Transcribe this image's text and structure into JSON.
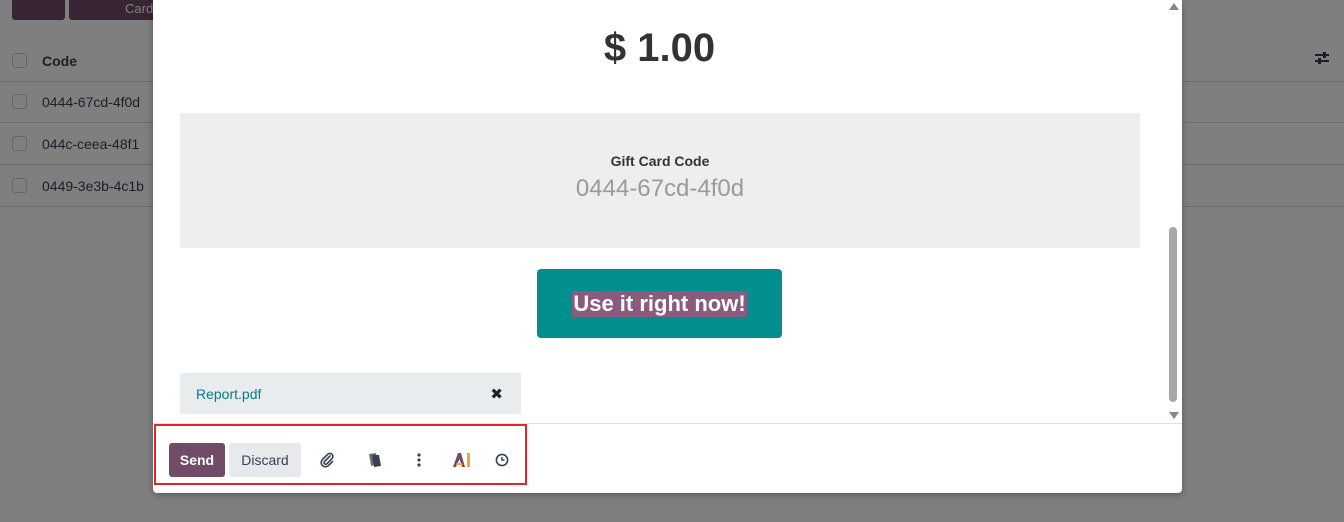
{
  "background": {
    "top_button_partial": "Card",
    "list": {
      "column_header": "Code",
      "rows": [
        "0444-67cd-4f0d",
        "044c-ceea-48f1",
        "0449-3e3b-4c1b"
      ]
    }
  },
  "dialog": {
    "amount": "$ 1.00",
    "gift_card": {
      "label": "Gift Card Code",
      "code": "0444-67cd-4f0d"
    },
    "cta_label": "Use it right now!",
    "attachment": {
      "filename": "Report.pdf",
      "remove_symbol": "✖"
    },
    "footer": {
      "send_label": "Send",
      "discard_label": "Discard",
      "icons": [
        "paperclip-icon",
        "template-icon",
        "more-options-icon",
        "ai-icon",
        "schedule-icon"
      ]
    }
  },
  "colors": {
    "primary": "#714b67",
    "cta": "#008f8c",
    "link": "#017e84",
    "highlight_border": "#e0252b"
  }
}
